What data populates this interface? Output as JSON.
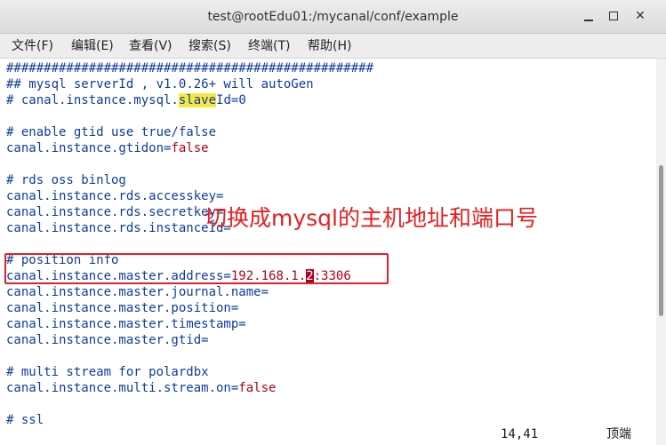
{
  "window": {
    "title": "test@rootEdu01:/mycanal/conf/example"
  },
  "menu": {
    "file": "文件(F)",
    "edit": "编辑(E)",
    "view": "查看(V)",
    "search": "搜索(S)",
    "terminal": "终端(T)",
    "help": "帮助(H)"
  },
  "editor": {
    "lines": {
      "l01": "#################################################",
      "l02": "## mysql serverId , v1.0.26+ will autoGen",
      "l03a": "# canal.instance.mysql.",
      "l03b": "slave",
      "l03c": "Id=0",
      "l05": "# enable gtid use true/false",
      "l06a": "canal.instance.gtidon=",
      "l06b": "false",
      "l08": "# rds oss binlog",
      "l09": "canal.instance.rds.accesskey=",
      "l10": "canal.instance.rds.secretkey=",
      "l11": "canal.instance.rds.instanceId=",
      "l13": "# position info",
      "l14a": "canal.instance.master.address=",
      "l14b": "192.168.1.",
      "l14c": "2",
      "l14d": ":3306",
      "l15": "canal.instance.master.journal.name=",
      "l16": "canal.instance.master.position=",
      "l17": "canal.instance.master.timestamp=",
      "l18": "canal.instance.master.gtid=",
      "l20": "# multi stream for polardbx",
      "l21a": "canal.instance.multi.stream.on=",
      "l21b": "false",
      "l23": "# ssl"
    }
  },
  "status": {
    "cursor_pos": "14,41",
    "scroll_pos": "顶端"
  },
  "annotation": {
    "text": "切换成mysql的主机地址和端口号",
    "color": "#e62020"
  }
}
